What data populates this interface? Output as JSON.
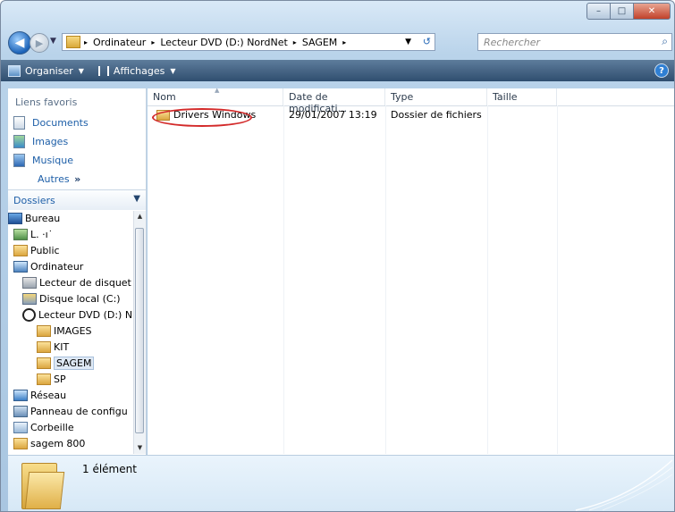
{
  "window": {
    "caption_buttons": {
      "minimize": "–",
      "maximize": "□",
      "close": "✕"
    }
  },
  "address": {
    "breadcrumbs": [
      "Ordinateur",
      "Lecteur DVD (D:) NordNet",
      "SAGEM"
    ],
    "separator": "▸"
  },
  "search": {
    "placeholder": "Rechercher"
  },
  "toolbar": {
    "organize_label": "Organiser",
    "views_label": "Affichages",
    "help": "?"
  },
  "favorites": {
    "title": "Liens favoris",
    "items": [
      {
        "label": "Documents",
        "icon": "documents-icon"
      },
      {
        "label": "Images",
        "icon": "images-icon"
      },
      {
        "label": "Musique",
        "icon": "music-icon"
      }
    ],
    "more_label": "Autres",
    "more_chevron": "»"
  },
  "folders": {
    "title": "Dossiers",
    "tree": [
      {
        "label": "Bureau",
        "icon": "desktop-icon"
      },
      {
        "label": "L. ‧ı˙",
        "icon": "user-folder-icon"
      },
      {
        "label": "Public",
        "icon": "folder-icon"
      },
      {
        "label": "Ordinateur",
        "icon": "computer-icon"
      },
      {
        "label": "Lecteur de disquet",
        "icon": "floppy-icon"
      },
      {
        "label": "Disque local (C:)",
        "icon": "local-disk-icon"
      },
      {
        "label": "Lecteur DVD (D:) N",
        "icon": "dvd-icon"
      },
      {
        "label": "IMAGES",
        "icon": "folder-icon"
      },
      {
        "label": "KIT",
        "icon": "folder-icon"
      },
      {
        "label": "SAGEM",
        "icon": "folder-icon",
        "selected": true
      },
      {
        "label": "SP",
        "icon": "folder-icon"
      },
      {
        "label": "Réseau",
        "icon": "network-icon"
      },
      {
        "label": "Panneau de configu",
        "icon": "control-panel-icon"
      },
      {
        "label": "Corbeille",
        "icon": "recycle-bin-icon"
      },
      {
        "label": "sagem 800",
        "icon": "folder-icon"
      }
    ]
  },
  "filelist": {
    "columns": [
      "Nom",
      "Date de modificati...",
      "Type",
      "Taille"
    ],
    "rows": [
      {
        "name": "Drivers Windows",
        "date": "29/01/2007 13:19",
        "type": "Dossier de fichiers",
        "size": ""
      }
    ]
  },
  "details": {
    "count_text": "1 élément"
  }
}
